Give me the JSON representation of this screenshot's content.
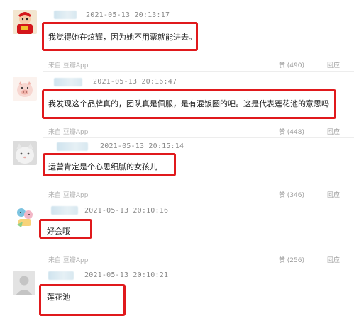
{
  "comments": [
    {
      "time": "2021-05-13 20:13:17",
      "content": "我觉得她在炫耀，因为她不用票就能进去。",
      "source": "来自 豆瓣App",
      "like": "赞 (490)",
      "reply": "回应",
      "avatar_icon": "red-mascot-avatar-icon"
    },
    {
      "time": "2021-05-13 20:16:47",
      "content": "我发现这个品牌真的，团队真是佩服，是有混饭圈的吧。这是代表莲花池的意思吗",
      "source": "来自 豆瓣App",
      "like": "赞 (448)",
      "reply": "回应",
      "avatar_icon": "pig-avatar-icon"
    },
    {
      "time": "2021-05-13 20:15:14",
      "content": "运营肯定是个心思细腻的女孩儿",
      "source": "来自 豆瓣App",
      "like": "赞 (346)",
      "reply": "回应",
      "avatar_icon": "cat-avatar-icon"
    },
    {
      "time": "2021-05-13 20:10:16",
      "content": "好会哦",
      "source": "来自 豆瓣App",
      "like": "赞 (256)",
      "reply": "回应",
      "avatar_icon": "cartoon-avatar-icon"
    },
    {
      "time": "2021-05-13 20:10:21",
      "content": "莲花池",
      "avatar_icon": "default-user-avatar-icon"
    }
  ],
  "colors": {
    "highlight": "#e0191c",
    "meta_text": "#b0b0b0",
    "time_text": "#8a8a8a"
  }
}
